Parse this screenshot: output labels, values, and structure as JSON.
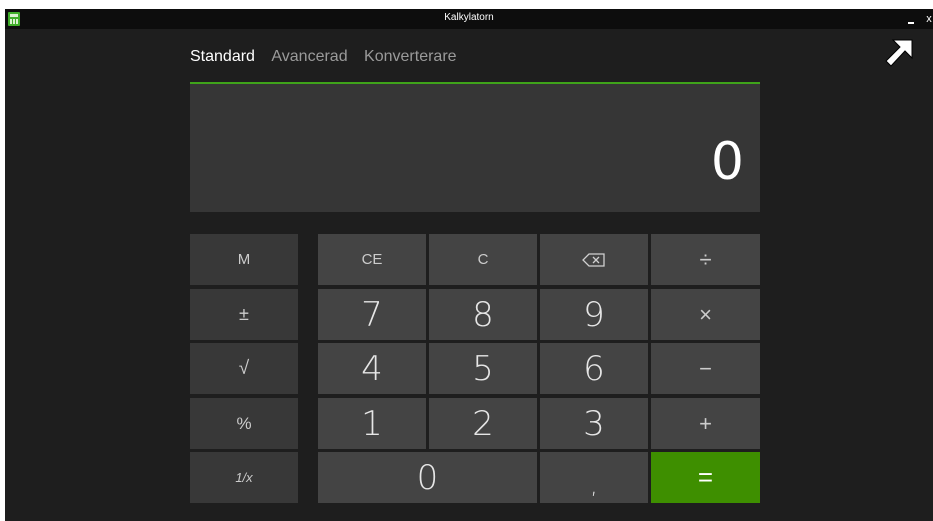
{
  "window": {
    "title": "Kalkylatorn",
    "minimize_glyph": "–",
    "close_glyph": "x"
  },
  "tabs": [
    {
      "label": "Standard",
      "active": true
    },
    {
      "label": "Avancerad",
      "active": false
    },
    {
      "label": "Konverterare",
      "active": false
    }
  ],
  "display": {
    "value": "0"
  },
  "keys": {
    "memory": [
      "M",
      "±",
      "√",
      "%",
      "1/x"
    ],
    "row1": [
      "CE",
      "C",
      "backspace",
      "÷"
    ],
    "row2": [
      "7",
      "8",
      "9",
      "×"
    ],
    "row3": [
      "4",
      "5",
      "6",
      "−"
    ],
    "row4": [
      "1",
      "2",
      "3",
      "+"
    ],
    "row5": [
      "0",
      ",",
      "="
    ]
  },
  "colors": {
    "accent": "#3fa31a",
    "equals_bg": "#3e8f00",
    "key_bg": "#444444",
    "background": "#1e1e1e"
  },
  "icons": [
    "calculator-app-icon",
    "backspace-icon",
    "mouse-cursor-icon"
  ]
}
